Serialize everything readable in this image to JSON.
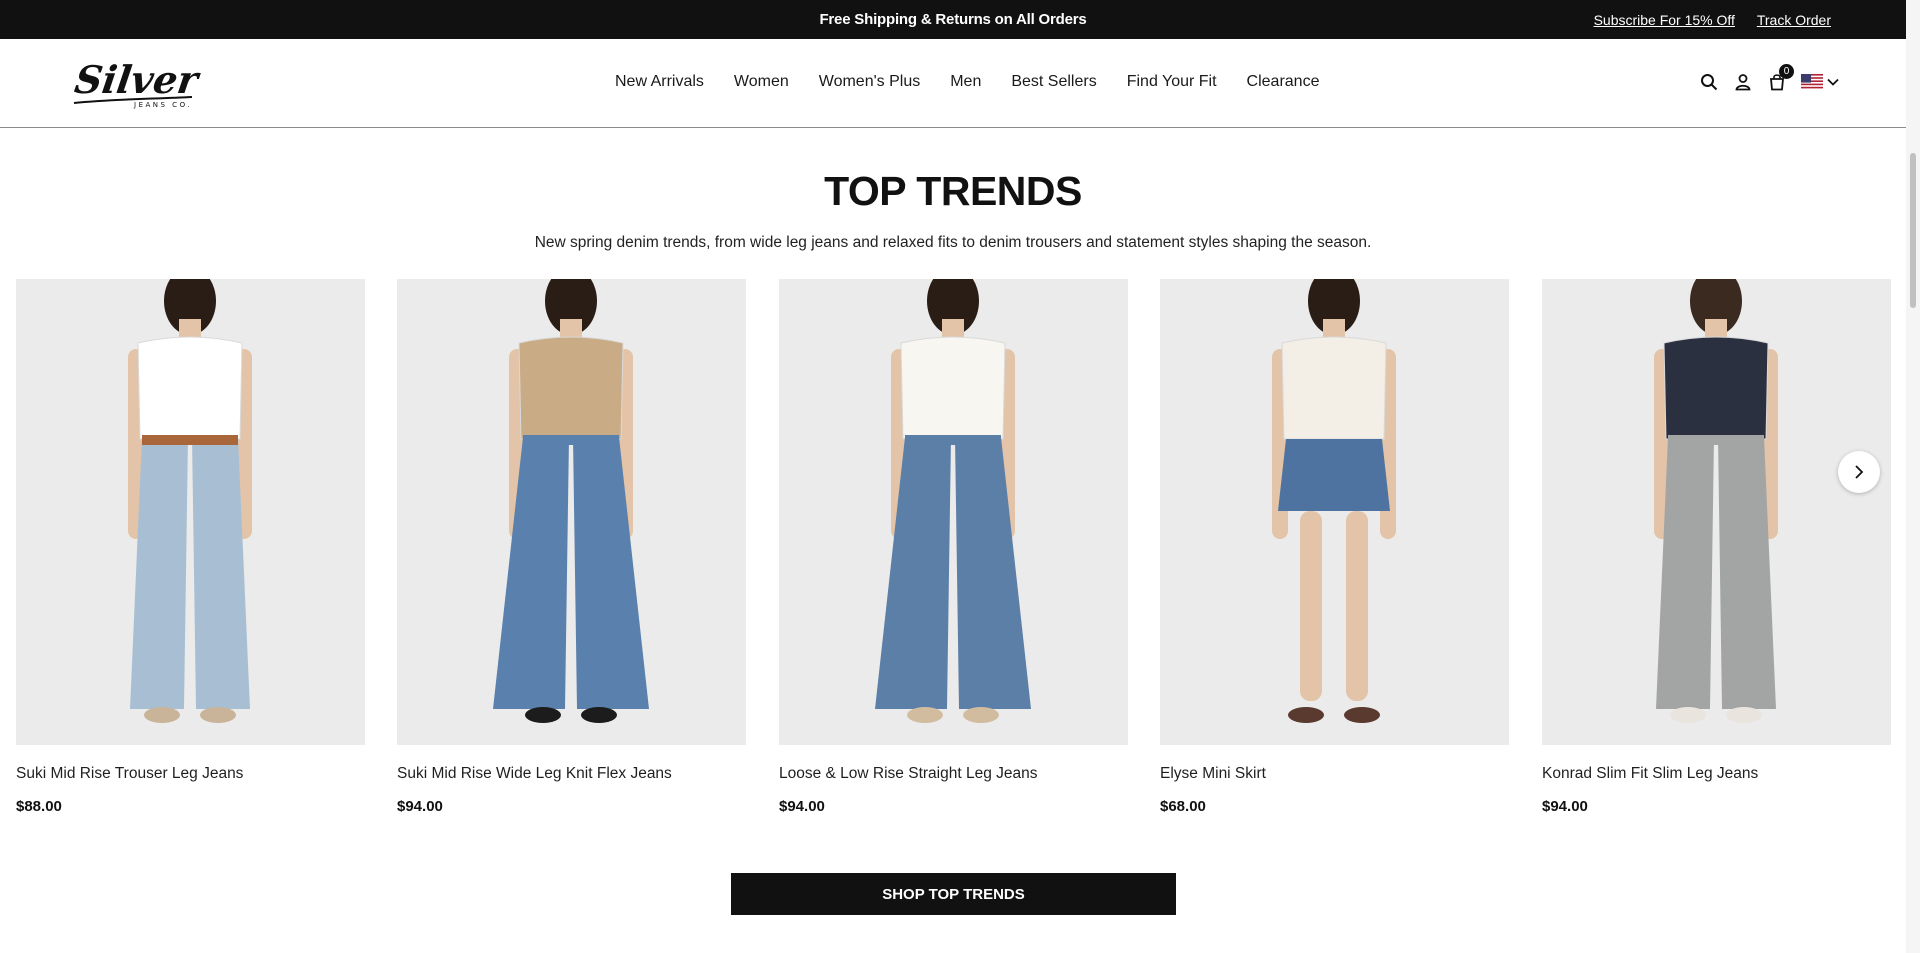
{
  "announcement": {
    "message": "Free Shipping & Returns on All Orders",
    "subscribe_label": "Subscribe For 15% Off",
    "track_label": "Track Order"
  },
  "header": {
    "logo_text": "Silver",
    "logo_subtext": "JEANS CO.",
    "nav": [
      "New Arrivals",
      "Women",
      "Women's Plus",
      "Men",
      "Best Sellers",
      "Find Your Fit",
      "Clearance"
    ],
    "cart_count": "0",
    "icons": [
      "search-icon",
      "account-icon",
      "cart-icon",
      "us-flag-icon",
      "chevron-down-icon"
    ]
  },
  "section": {
    "title": "TOP TRENDS",
    "subtitle": "New spring denim trends, from wide leg jeans and relaxed fits to denim trousers and statement styles shaping the season.",
    "cta_label": "SHOP TOP TRENDS"
  },
  "products": [
    {
      "name": "Suki Mid Rise Trouser Leg Jeans",
      "price": "$88.00",
      "top_color": "#ffffff",
      "denim_color": "#a8bfd3",
      "shoe_color": "#c9b49a"
    },
    {
      "name": "Suki Mid Rise Wide Leg Knit Flex Jeans",
      "price": "$94.00",
      "top_color": "#c9ab86",
      "denim_color": "#5a80ad",
      "shoe_color": "#1c1c1c"
    },
    {
      "name": "Loose & Low Rise Straight Leg Jeans",
      "price": "$94.00",
      "top_color": "#f8f6f1",
      "denim_color": "#5c7fa8",
      "shoe_color": "#d2bca0"
    },
    {
      "name": "Elyse Mini Skirt",
      "price": "$68.00",
      "top_color": "#f3efe6",
      "denim_color": "#4f73a0",
      "shoe_color": "#5a3a2e"
    },
    {
      "name": "Konrad Slim Fit Slim Leg Jeans",
      "price": "$94.00",
      "top_color": "#2b3040",
      "denim_color": "#a3a4a4",
      "shoe_color": "#e9e5de"
    }
  ]
}
